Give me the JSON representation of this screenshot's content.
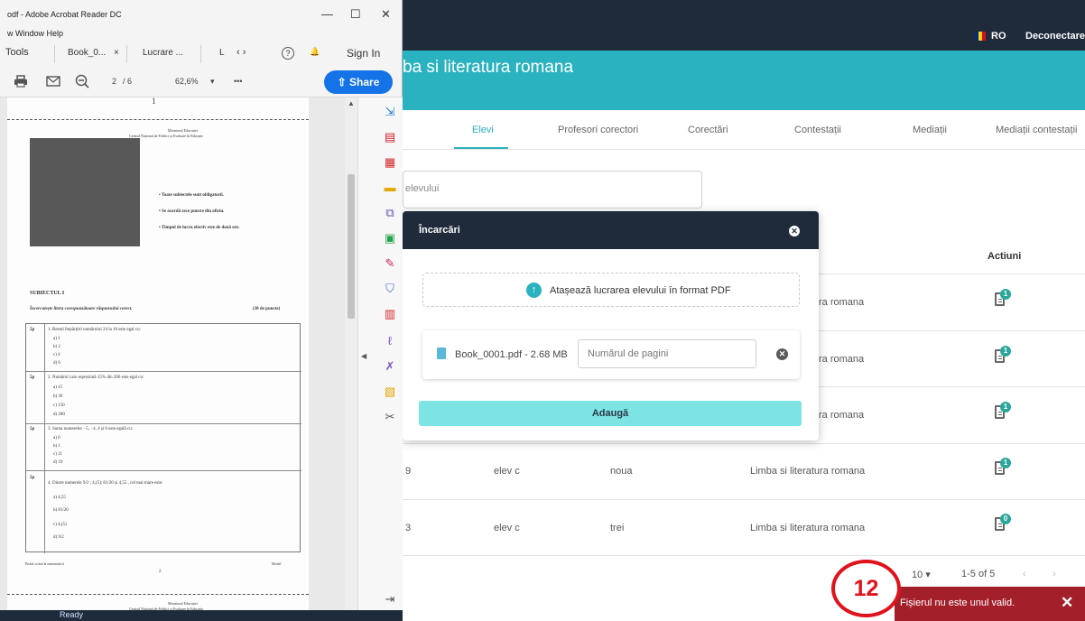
{
  "web": {
    "topbar": {
      "lang": "RO",
      "logout": "Deconectare",
      "flag_colors": [
        "#002b7f",
        "#fcd116",
        "#ce1126"
      ]
    },
    "banner_title": "ba si literatura romana",
    "tabs": [
      {
        "label": "Elevi",
        "active": true
      },
      {
        "label": "Profesori corectori"
      },
      {
        "label": "Corectări"
      },
      {
        "label": "Contestații"
      },
      {
        "label": "Mediații"
      },
      {
        "label": "Mediații contestații"
      }
    ],
    "search_placeholder": "elevului",
    "table": {
      "actions_header": "Actiuni",
      "rows": [
        {
          "num": "",
          "student": "",
          "code": "",
          "subject": "ra romana",
          "badge": "1"
        },
        {
          "num": "",
          "student": "",
          "code": "",
          "subject": "ra romana",
          "badge": "1"
        },
        {
          "num": "",
          "student": "",
          "code": "",
          "subject": "ra romana",
          "badge": "1"
        },
        {
          "num": "9",
          "student": "elev c",
          "code": "noua",
          "subject": "Limba si literatura romana",
          "badge": "1"
        },
        {
          "num": "3",
          "student": "elev c",
          "code": "trei",
          "subject": "Limba si literatura romana",
          "badge": "0"
        }
      ]
    },
    "pager": {
      "per_page": "10 ▾",
      "range": "1-5 of 5",
      "prev": "‹",
      "next": "›"
    }
  },
  "modal": {
    "title": "Încarcări",
    "close": "✕",
    "attach_label": "Atașează lucrarea elevului în format PDF",
    "file_name": "Book_0001.pdf - 2.68 MB",
    "pages_placeholder": "Numărul de pagini",
    "remove": "✕",
    "add_label": "Adaugă"
  },
  "toast": {
    "text": "Fișierul nu este unul valid.",
    "close": "✕"
  },
  "step_badge": "12",
  "acrobat": {
    "title": "odf - Adobe Acrobat Reader DC",
    "menu": "w   Window   Help",
    "controls": {
      "min": "—",
      "max": "☐",
      "close": "✕"
    },
    "tabs": {
      "tools": "Tools",
      "file1": "Book_0...",
      "file1_close": "×",
      "file2": "Lucrare ...",
      "file3": "L",
      "nav": "‹  ›",
      "help": "?",
      "bell": "🔔",
      "signin": "Sign In"
    },
    "toolbar": {
      "page_current": "2",
      "page_total": "/ 6",
      "zoom": "62,6%",
      "zoom_arrow": "▾",
      "more": "•••",
      "share": "Share"
    },
    "page": {
      "ministry1": "Ministerul Educației",
      "ministry2": "Centrul Național de Politici și Evaluare în Educație",
      "rule1": "• Toate subiectele sunt obligatorii.",
      "rule2": "• Se acordă zece puncte din oficiu.",
      "rule3": "• Timpul de lucru efectiv este de două ore.",
      "section": "SUBIECTUL I",
      "instruction": "Încercuiește litera corespunzătoare răspunsului corect.",
      "points": "(30 de puncte)",
      "q1": "1. Restul împărțirii numărului 24 la 10 este egal cu:",
      "q1_opts": [
        "a)  1",
        "b)  2",
        "c)  4",
        "d)  6"
      ],
      "q2": "2. Numărul care reprezintă 15% din 200 este egal cu:",
      "q2_opts": [
        "a)  15",
        "b)  30",
        "c)  150",
        "d)  200"
      ],
      "q3": "3. Suma numerelor −5, −4, 4 și 6 este egală cu:",
      "q3_opts": [
        "a)  0",
        "b)  1",
        "c)  11",
        "d)  19"
      ],
      "q4": "4. Dintre numerele 9/2 ; 4,(5); 81/20 și 4,55 , cel mai mare este:",
      "q4_opts": [
        "a)  4,55",
        "b)  81/20",
        "c)  4,(5)",
        "d)  9/2"
      ],
      "score": "5p",
      "footer_left": "Probă scrisă la matematică",
      "footer_mid": "2",
      "footer_right": "Model",
      "next_ministry1": "Ministerul Educației",
      "next_ministry2": "Centrul Național de Politici și Evaluare în Educație",
      "top_mark": "1"
    },
    "status": "Ready"
  }
}
